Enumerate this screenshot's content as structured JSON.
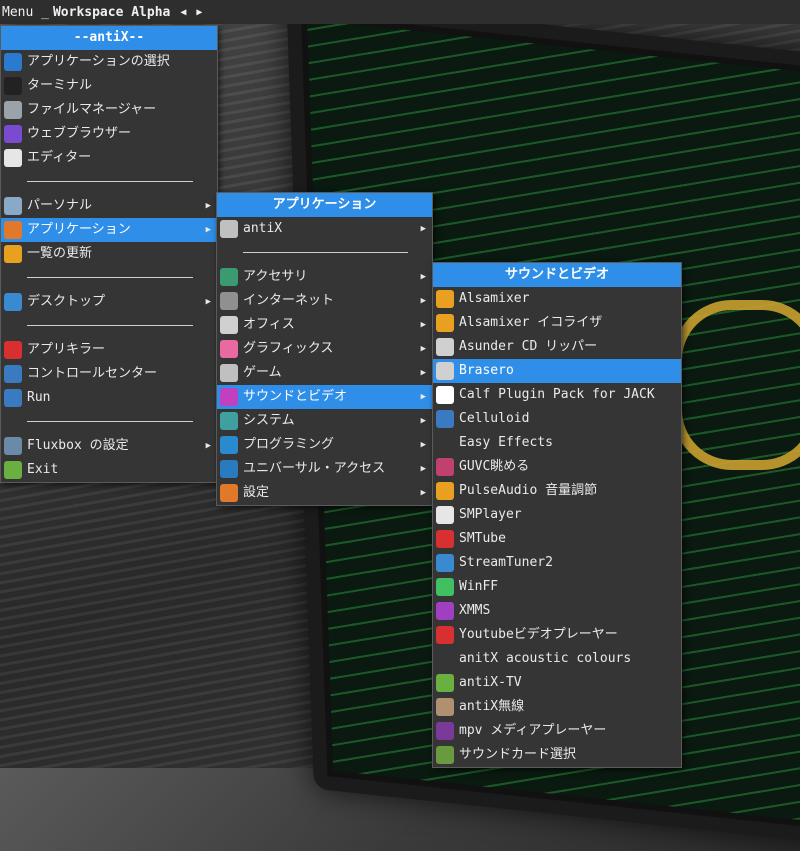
{
  "topbar": {
    "menu_label": "Menu _",
    "workspace": "Workspace Alpha",
    "prev_icon": "◀",
    "next_icon": "▶"
  },
  "main_menu": {
    "title": "--antiX--",
    "items": [
      {
        "label": "アプリケーションの選択",
        "icon": "search-icon",
        "color": "#2a7bd0"
      },
      {
        "label": "ターミナル",
        "icon": "terminal-icon",
        "color": "#222"
      },
      {
        "label": "ファイルマネージャー",
        "icon": "file-manager-icon",
        "color": "#9aa3aa"
      },
      {
        "label": "ウェブブラウザー",
        "icon": "browser-icon",
        "color": "#7a4bd0"
      },
      {
        "label": "エディター",
        "icon": "editor-icon",
        "color": "#e6e6e6"
      },
      {
        "separator": true
      },
      {
        "label": "パーソナル",
        "icon": "person-icon",
        "color": "#8aa8c8",
        "submenu": true
      },
      {
        "label": "アプリケーション",
        "icon": "apps-grid-icon",
        "color": "#e07a2a",
        "submenu": true,
        "active": true
      },
      {
        "label": "一覧の更新",
        "icon": "refresh-icon",
        "color": "#e8a020"
      },
      {
        "separator": true
      },
      {
        "label": "デスクトップ",
        "icon": "desktop-icon",
        "color": "#3a8ad0",
        "submenu": true
      },
      {
        "separator": true
      },
      {
        "label": "アプリキラー",
        "icon": "close-icon",
        "color": "#d83030"
      },
      {
        "label": "コントロールセンター",
        "icon": "control-center-icon",
        "color": "#3a7ac0"
      },
      {
        "label": "Run",
        "icon": "gear-icon",
        "color": "#3a7ac0"
      },
      {
        "separator": true
      },
      {
        "label": "Fluxbox の設定",
        "icon": "settings-icon",
        "color": "#6a8aa8",
        "submenu": true
      },
      {
        "label": "Exit",
        "icon": "exit-icon",
        "color": "#6ab040"
      }
    ]
  },
  "apps_menu": {
    "title": "アプリケーション",
    "items": [
      {
        "label": "antiX",
        "icon": "tools-icon",
        "color": "#c0c0c0",
        "submenu": true
      },
      {
        "separator": true
      },
      {
        "label": "アクセサリ",
        "icon": "accessories-icon",
        "color": "#3a9a70",
        "submenu": true
      },
      {
        "label": "インターネット",
        "icon": "network-icon",
        "color": "#909090",
        "submenu": true
      },
      {
        "label": "オフィス",
        "icon": "office-icon",
        "color": "#d0d0d0",
        "submenu": true
      },
      {
        "label": "グラフィックス",
        "icon": "graphics-icon",
        "color": "#e86aa0",
        "submenu": true
      },
      {
        "label": "ゲーム",
        "icon": "game-icon",
        "color": "#c0c0c0",
        "submenu": true
      },
      {
        "label": "サウンドとビデオ",
        "icon": "multimedia-icon",
        "color": "#c040c0",
        "submenu": true,
        "active": true
      },
      {
        "label": "システム",
        "icon": "system-icon",
        "color": "#40a0a0",
        "submenu": true
      },
      {
        "label": "プログラミング",
        "icon": "programming-icon",
        "color": "#2a8ad0",
        "submenu": true
      },
      {
        "label": "ユニバーサル・アクセス",
        "icon": "accessibility-icon",
        "color": "#2a7ac0",
        "submenu": true
      },
      {
        "label": "設定",
        "icon": "preferences-icon",
        "color": "#e07a2a",
        "submenu": true
      }
    ]
  },
  "sound_menu": {
    "title": "サウンドとビデオ",
    "items": [
      {
        "label": "Alsamixer",
        "icon": "speaker-icon",
        "color": "#e8a020"
      },
      {
        "label": "Alsamixer イコライザ",
        "icon": "speaker-icon",
        "color": "#e8a020"
      },
      {
        "label": "Asunder CD リッパー",
        "icon": "cd-ripper-icon",
        "color": "#d0d0d0"
      },
      {
        "label": "Brasero",
        "icon": "cd-burner-icon",
        "color": "#d0d0d0",
        "active": true
      },
      {
        "label": "Calf Plugin Pack for JACK",
        "icon": "calf-icon",
        "color": "#ffffff"
      },
      {
        "label": "Celluloid",
        "icon": "celluloid-icon",
        "color": "#3a7ac0"
      },
      {
        "label": "Easy Effects",
        "icon": "",
        "color": ""
      },
      {
        "label": "GUVC眺める",
        "icon": "webcam-icon",
        "color": "#c04070"
      },
      {
        "label": "PulseAudio 音量調節",
        "icon": "volume-icon",
        "color": "#e8a020"
      },
      {
        "label": "SMPlayer",
        "icon": "smplayer-icon",
        "color": "#e6e6e6"
      },
      {
        "label": "SMTube",
        "icon": "youtube-icon",
        "color": "#d83030"
      },
      {
        "label": "StreamTuner2",
        "icon": "music-note-icon",
        "color": "#3a8ad0"
      },
      {
        "label": "WinFF",
        "icon": "winff-icon",
        "color": "#40c060"
      },
      {
        "label": "XMMS",
        "icon": "xmms-icon",
        "color": "#a040c0"
      },
      {
        "label": "Youtubeビデオプレーヤー",
        "icon": "youtube-icon",
        "color": "#d83030"
      },
      {
        "label": "anitX acoustic colours",
        "icon": "",
        "color": ""
      },
      {
        "label": "antiX-TV",
        "icon": "tv-icon",
        "color": "#6ab040"
      },
      {
        "label": "antiX無線",
        "icon": "radio-icon",
        "color": "#b09070"
      },
      {
        "label": "mpv メディアプレーヤー",
        "icon": "mpv-icon",
        "color": "#7a3a9a"
      },
      {
        "label": "サウンドカード選択",
        "icon": "soundcard-icon",
        "color": "#6a9a40"
      }
    ]
  }
}
